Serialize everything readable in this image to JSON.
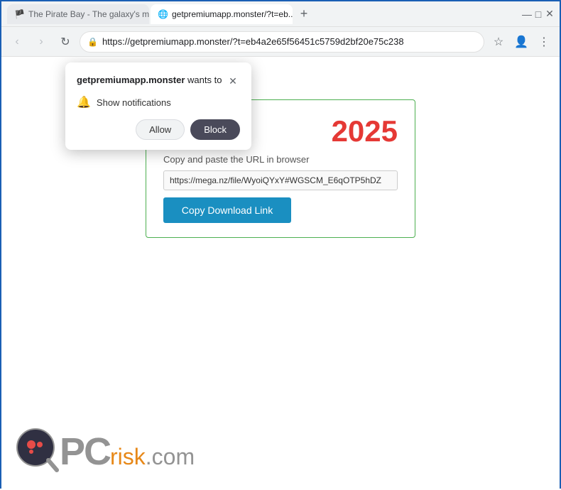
{
  "browser": {
    "tabs": [
      {
        "id": "tab1",
        "label": "The Pirate Bay - The galaxy's m...",
        "active": false,
        "favicon": "🏴"
      },
      {
        "id": "tab2",
        "label": "getpremiumapp.monster/?t=eb...",
        "active": true,
        "favicon": "🌐"
      }
    ],
    "new_tab_label": "+",
    "address": "https://getpremiumapp.monster/?t=eb4a2e65f56451c5759d2bf20e75c238",
    "window_controls": {
      "minimize": "—",
      "maximize": "□",
      "close": "✕"
    }
  },
  "nav": {
    "back": "‹",
    "forward": "›",
    "reload": "↻"
  },
  "notification_popup": {
    "site": "getpremiumapp.monster",
    "wants_to": " wants to",
    "notification_label": "Show notifications",
    "allow_label": "Allow",
    "block_label": "Block",
    "close_icon": "✕"
  },
  "download_card": {
    "year": "2025",
    "url_label": "Copy and paste the URL in browser",
    "url_value": "https://mega.nz/file/WyoiQYxY#WGSCM_E6qOTP5hDZ",
    "copy_button_label": "Copy Download Link"
  },
  "pcrisk": {
    "pc_text": "PC",
    "risk_text": "risk",
    "com_text": ".com"
  }
}
